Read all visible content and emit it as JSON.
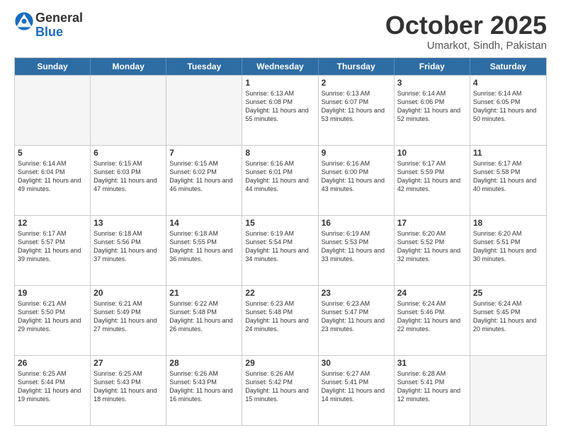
{
  "logo": {
    "general": "General",
    "blue": "Blue"
  },
  "title": "October 2025",
  "location": "Umarkot, Sindh, Pakistan",
  "weekdays": [
    "Sunday",
    "Monday",
    "Tuesday",
    "Wednesday",
    "Thursday",
    "Friday",
    "Saturday"
  ],
  "rows": [
    [
      {
        "day": "",
        "sunrise": "",
        "sunset": "",
        "daylight": ""
      },
      {
        "day": "",
        "sunrise": "",
        "sunset": "",
        "daylight": ""
      },
      {
        "day": "",
        "sunrise": "",
        "sunset": "",
        "daylight": ""
      },
      {
        "day": "1",
        "sunrise": "Sunrise: 6:13 AM",
        "sunset": "Sunset: 6:08 PM",
        "daylight": "Daylight: 11 hours and 55 minutes."
      },
      {
        "day": "2",
        "sunrise": "Sunrise: 6:13 AM",
        "sunset": "Sunset: 6:07 PM",
        "daylight": "Daylight: 11 hours and 53 minutes."
      },
      {
        "day": "3",
        "sunrise": "Sunrise: 6:14 AM",
        "sunset": "Sunset: 6:06 PM",
        "daylight": "Daylight: 11 hours and 52 minutes."
      },
      {
        "day": "4",
        "sunrise": "Sunrise: 6:14 AM",
        "sunset": "Sunset: 6:05 PM",
        "daylight": "Daylight: 11 hours and 50 minutes."
      }
    ],
    [
      {
        "day": "5",
        "sunrise": "Sunrise: 6:14 AM",
        "sunset": "Sunset: 6:04 PM",
        "daylight": "Daylight: 11 hours and 49 minutes."
      },
      {
        "day": "6",
        "sunrise": "Sunrise: 6:15 AM",
        "sunset": "Sunset: 6:03 PM",
        "daylight": "Daylight: 11 hours and 47 minutes."
      },
      {
        "day": "7",
        "sunrise": "Sunrise: 6:15 AM",
        "sunset": "Sunset: 6:02 PM",
        "daylight": "Daylight: 11 hours and 46 minutes."
      },
      {
        "day": "8",
        "sunrise": "Sunrise: 6:16 AM",
        "sunset": "Sunset: 6:01 PM",
        "daylight": "Daylight: 11 hours and 44 minutes."
      },
      {
        "day": "9",
        "sunrise": "Sunrise: 6:16 AM",
        "sunset": "Sunset: 6:00 PM",
        "daylight": "Daylight: 11 hours and 43 minutes."
      },
      {
        "day": "10",
        "sunrise": "Sunrise: 6:17 AM",
        "sunset": "Sunset: 5:59 PM",
        "daylight": "Daylight: 11 hours and 42 minutes."
      },
      {
        "day": "11",
        "sunrise": "Sunrise: 6:17 AM",
        "sunset": "Sunset: 5:58 PM",
        "daylight": "Daylight: 11 hours and 40 minutes."
      }
    ],
    [
      {
        "day": "12",
        "sunrise": "Sunrise: 6:17 AM",
        "sunset": "Sunset: 5:57 PM",
        "daylight": "Daylight: 11 hours and 39 minutes."
      },
      {
        "day": "13",
        "sunrise": "Sunrise: 6:18 AM",
        "sunset": "Sunset: 5:56 PM",
        "daylight": "Daylight: 11 hours and 37 minutes."
      },
      {
        "day": "14",
        "sunrise": "Sunrise: 6:18 AM",
        "sunset": "Sunset: 5:55 PM",
        "daylight": "Daylight: 11 hours and 36 minutes."
      },
      {
        "day": "15",
        "sunrise": "Sunrise: 6:19 AM",
        "sunset": "Sunset: 5:54 PM",
        "daylight": "Daylight: 11 hours and 34 minutes."
      },
      {
        "day": "16",
        "sunrise": "Sunrise: 6:19 AM",
        "sunset": "Sunset: 5:53 PM",
        "daylight": "Daylight: 11 hours and 33 minutes."
      },
      {
        "day": "17",
        "sunrise": "Sunrise: 6:20 AM",
        "sunset": "Sunset: 5:52 PM",
        "daylight": "Daylight: 11 hours and 32 minutes."
      },
      {
        "day": "18",
        "sunrise": "Sunrise: 6:20 AM",
        "sunset": "Sunset: 5:51 PM",
        "daylight": "Daylight: 11 hours and 30 minutes."
      }
    ],
    [
      {
        "day": "19",
        "sunrise": "Sunrise: 6:21 AM",
        "sunset": "Sunset: 5:50 PM",
        "daylight": "Daylight: 11 hours and 29 minutes."
      },
      {
        "day": "20",
        "sunrise": "Sunrise: 6:21 AM",
        "sunset": "Sunset: 5:49 PM",
        "daylight": "Daylight: 11 hours and 27 minutes."
      },
      {
        "day": "21",
        "sunrise": "Sunrise: 6:22 AM",
        "sunset": "Sunset: 5:48 PM",
        "daylight": "Daylight: 11 hours and 26 minutes."
      },
      {
        "day": "22",
        "sunrise": "Sunrise: 6:23 AM",
        "sunset": "Sunset: 5:48 PM",
        "daylight": "Daylight: 11 hours and 24 minutes."
      },
      {
        "day": "23",
        "sunrise": "Sunrise: 6:23 AM",
        "sunset": "Sunset: 5:47 PM",
        "daylight": "Daylight: 11 hours and 23 minutes."
      },
      {
        "day": "24",
        "sunrise": "Sunrise: 6:24 AM",
        "sunset": "Sunset: 5:46 PM",
        "daylight": "Daylight: 11 hours and 22 minutes."
      },
      {
        "day": "25",
        "sunrise": "Sunrise: 6:24 AM",
        "sunset": "Sunset: 5:45 PM",
        "daylight": "Daylight: 11 hours and 20 minutes."
      }
    ],
    [
      {
        "day": "26",
        "sunrise": "Sunrise: 6:25 AM",
        "sunset": "Sunset: 5:44 PM",
        "daylight": "Daylight: 11 hours and 19 minutes."
      },
      {
        "day": "27",
        "sunrise": "Sunrise: 6:25 AM",
        "sunset": "Sunset: 5:43 PM",
        "daylight": "Daylight: 11 hours and 18 minutes."
      },
      {
        "day": "28",
        "sunrise": "Sunrise: 6:26 AM",
        "sunset": "Sunset: 5:43 PM",
        "daylight": "Daylight: 11 hours and 16 minutes."
      },
      {
        "day": "29",
        "sunrise": "Sunrise: 6:26 AM",
        "sunset": "Sunset: 5:42 PM",
        "daylight": "Daylight: 11 hours and 15 minutes."
      },
      {
        "day": "30",
        "sunrise": "Sunrise: 6:27 AM",
        "sunset": "Sunset: 5:41 PM",
        "daylight": "Daylight: 11 hours and 14 minutes."
      },
      {
        "day": "31",
        "sunrise": "Sunrise: 6:28 AM",
        "sunset": "Sunset: 5:41 PM",
        "daylight": "Daylight: 11 hours and 12 minutes."
      },
      {
        "day": "",
        "sunrise": "",
        "sunset": "",
        "daylight": ""
      }
    ]
  ]
}
